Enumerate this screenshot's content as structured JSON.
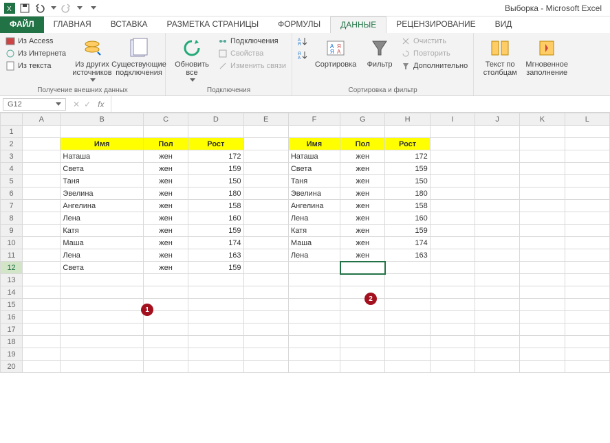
{
  "app": {
    "title": "Выборка - Microsoft Excel"
  },
  "tabs": {
    "file": "ФАЙЛ",
    "home": "ГЛАВНАЯ",
    "insert": "ВСТАВКА",
    "layout": "РАЗМЕТКА СТРАНИЦЫ",
    "formulas": "ФОРМУЛЫ",
    "data": "ДАННЫЕ",
    "review": "РЕЦЕНЗИРОВАНИЕ",
    "view": "ВИД"
  },
  "ribbon": {
    "ext": {
      "access": "Из Access",
      "web": "Из Интернета",
      "text": "Из текста",
      "other": "Из других источников",
      "existing": "Существующие подключения",
      "group": "Получение внешних данных"
    },
    "conn": {
      "refresh": "Обновить все",
      "connections": "Подключения",
      "properties": "Свойства",
      "editlinks": "Изменить связи",
      "group": "Подключения"
    },
    "sort": {
      "sort": "Сортировка",
      "filter": "Фильтр",
      "clear": "Очистить",
      "reapply": "Повторить",
      "advanced": "Дополнительно",
      "group": "Сортировка и фильтр"
    },
    "tools": {
      "t2c": "Текст по столбцам",
      "flash": "Мгновенное заполнение"
    }
  },
  "namebox": "G12",
  "headers": {
    "name": "Имя",
    "sex": "Пол",
    "height": "Рост"
  },
  "table1": [
    {
      "name": "Наташа",
      "sex": "жен",
      "h": "172"
    },
    {
      "name": "Света",
      "sex": "жен",
      "h": "159"
    },
    {
      "name": "Таня",
      "sex": "жен",
      "h": "150"
    },
    {
      "name": "Эвелина",
      "sex": "жен",
      "h": "180"
    },
    {
      "name": "Ангелина",
      "sex": "жен",
      "h": "158"
    },
    {
      "name": "Лена",
      "sex": "жен",
      "h": "160"
    },
    {
      "name": "Катя",
      "sex": "жен",
      "h": "159"
    },
    {
      "name": "Маша",
      "sex": "жен",
      "h": "174"
    },
    {
      "name": "Лена",
      "sex": "жен",
      "h": "163"
    },
    {
      "name": "Света",
      "sex": "жен",
      "h": "159"
    }
  ],
  "table2": [
    {
      "name": "Наташа",
      "sex": "жен",
      "h": "172"
    },
    {
      "name": "Света",
      "sex": "жен",
      "h": "159"
    },
    {
      "name": "Таня",
      "sex": "жен",
      "h": "150"
    },
    {
      "name": "Эвелина",
      "sex": "жен",
      "h": "180"
    },
    {
      "name": "Ангелина",
      "sex": "жен",
      "h": "158"
    },
    {
      "name": "Лена",
      "sex": "жен",
      "h": "160"
    },
    {
      "name": "Катя",
      "sex": "жен",
      "h": "159"
    },
    {
      "name": "Маша",
      "sex": "жен",
      "h": "174"
    },
    {
      "name": "Лена",
      "sex": "жен",
      "h": "163"
    }
  ],
  "badges": {
    "b1": "1",
    "b2": "2"
  },
  "cols": [
    "A",
    "B",
    "C",
    "D",
    "E",
    "F",
    "G",
    "H",
    "I",
    "J",
    "K",
    "L"
  ]
}
